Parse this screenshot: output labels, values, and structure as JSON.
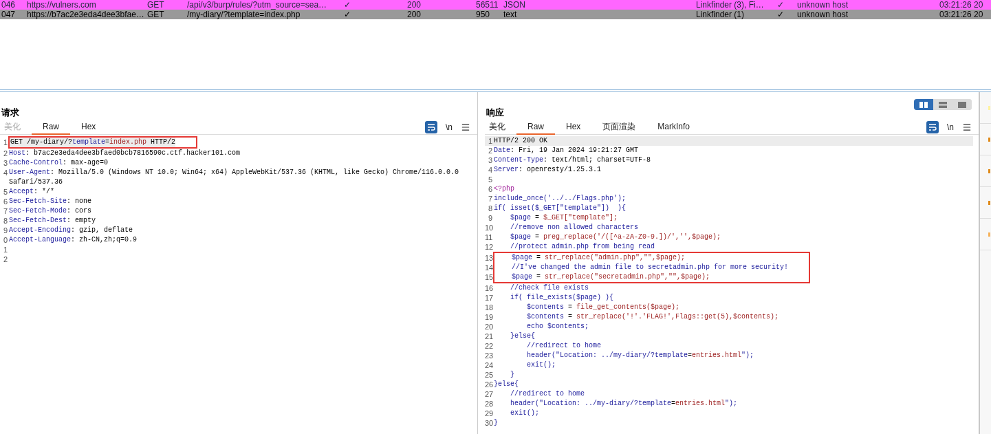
{
  "table": {
    "rows": [
      {
        "selected": false,
        "color": "#ff66ff",
        "cells": [
          "046",
          "https://vulners.com",
          "GET",
          "/api/v3/burp/rules/?utm_source=sea…",
          "✓",
          "200",
          "56511",
          "JSON",
          "Linkfinder (3), Fi…",
          "✓",
          "unknown host",
          "03:21:26 20"
        ]
      },
      {
        "selected": true,
        "color": "#999999",
        "cells": [
          "047",
          "https://b7ac2e3eda4dee3bfae…",
          "GET",
          "/my-diary/?template=index.php",
          "✓",
          "200",
          "950",
          "text",
          "Linkfinder (1)",
          "✓",
          "unknown host",
          "03:21:26 20"
        ]
      }
    ]
  },
  "request": {
    "title": "请求",
    "tabs": [
      {
        "label": "美化",
        "selected": false,
        "disabled": true
      },
      {
        "label": "Raw",
        "selected": true,
        "disabled": false
      },
      {
        "label": "Hex",
        "selected": false,
        "disabled": false
      }
    ],
    "newline_label": "\\n",
    "lines": [
      {
        "number": "1",
        "current": true,
        "boxed": true,
        "segments": [
          {
            "text": "GET /my-diary/?",
            "kind": "plain"
          },
          {
            "text": "template",
            "kind": "name"
          },
          {
            "text": "=",
            "kind": "plain"
          },
          {
            "text": "index.php",
            "kind": "value"
          },
          {
            "text": " HTTP/2",
            "kind": "plain"
          }
        ]
      },
      {
        "number": "2",
        "current": false,
        "boxed": false,
        "segments": [
          {
            "text": "Host",
            "kind": "name"
          },
          {
            "text": ": b7ac2e3eda4dee3bfaed0bcb7816590c.ctf.hacker101.com",
            "kind": "plain"
          }
        ]
      },
      {
        "number": "3",
        "current": false,
        "boxed": false,
        "segments": [
          {
            "text": "Cache-Control",
            "kind": "name"
          },
          {
            "text": ": max-age=0",
            "kind": "plain"
          }
        ]
      },
      {
        "number": "4",
        "current": false,
        "boxed": false,
        "segments": [
          {
            "text": "User-Agent",
            "kind": "name"
          },
          {
            "text": ": Mozilla/5.0 (Windows NT 10.0; Win64; x64) AppleWebKit/537.36 (KHTML, like Gecko) Chrome/116.0.0.0 Safari/537.36",
            "kind": "plain"
          }
        ]
      },
      {
        "number": "5",
        "current": false,
        "boxed": false,
        "segments": [
          {
            "text": "Accept",
            "kind": "name"
          },
          {
            "text": ": */*",
            "kind": "plain"
          }
        ]
      },
      {
        "number": "6",
        "current": false,
        "boxed": false,
        "segments": [
          {
            "text": "Sec-Fetch-Site",
            "kind": "name"
          },
          {
            "text": ": none",
            "kind": "plain"
          }
        ]
      },
      {
        "number": "7",
        "current": false,
        "boxed": false,
        "segments": [
          {
            "text": "Sec-Fetch-Mode",
            "kind": "name"
          },
          {
            "text": ": cors",
            "kind": "plain"
          }
        ]
      },
      {
        "number": "8",
        "current": false,
        "boxed": false,
        "segments": [
          {
            "text": "Sec-Fetch-Dest",
            "kind": "name"
          },
          {
            "text": ": empty",
            "kind": "plain"
          }
        ]
      },
      {
        "number": "9",
        "current": false,
        "boxed": false,
        "segments": [
          {
            "text": "Accept-Encoding",
            "kind": "name"
          },
          {
            "text": ": gzip, deflate",
            "kind": "plain"
          }
        ]
      },
      {
        "number": "0",
        "current": false,
        "boxed": false,
        "segments": [
          {
            "text": "Accept-Language",
            "kind": "name"
          },
          {
            "text": ": zh-CN,zh;q=0.9",
            "kind": "plain"
          }
        ]
      },
      {
        "number": "1",
        "current": false,
        "boxed": false
      },
      {
        "number": "2",
        "current": false,
        "boxed": false
      }
    ]
  },
  "response": {
    "title": "响应",
    "layout_toggle": [
      {
        "selected": true
      },
      {
        "selected": false
      },
      {
        "selected": false
      }
    ],
    "tabs": [
      {
        "label": "美化",
        "selected": false,
        "disabled": false
      },
      {
        "label": "Raw",
        "selected": true,
        "disabled": false
      },
      {
        "label": "Hex",
        "selected": false,
        "disabled": false
      },
      {
        "label": "页面渲染",
        "selected": false,
        "disabled": false
      },
      {
        "label": "MarkInfo",
        "selected": false,
        "disabled": false
      }
    ],
    "newline_label": "\\n",
    "lines": [
      {
        "number": "1",
        "current": true,
        "boxed": false,
        "segments": [
          {
            "text": "HTTP/2 200 OK",
            "kind": "plain"
          }
        ]
      },
      {
        "number": "2",
        "current": false,
        "boxed": false,
        "segments": [
          {
            "text": "Date",
            "kind": "name"
          },
          {
            "text": ": Fri, 19 Jan 2024 19:21:27 GMT",
            "kind": "plain"
          }
        ]
      },
      {
        "number": "3",
        "current": false,
        "boxed": false,
        "segments": [
          {
            "text": "Content-Type",
            "kind": "name"
          },
          {
            "text": ": text/html; charset=UTF-8",
            "kind": "plain"
          }
        ]
      },
      {
        "number": "4",
        "current": false,
        "boxed": false,
        "segments": [
          {
            "text": "Server",
            "kind": "name"
          },
          {
            "text": ": openresty/1.25.3.1",
            "kind": "plain"
          }
        ]
      },
      {
        "number": "5",
        "current": false,
        "boxed": false
      },
      {
        "number": "6",
        "current": false,
        "boxed": false,
        "segments": [
          {
            "text": "<?php",
            "kind": "tag"
          }
        ]
      },
      {
        "number": "7",
        "current": false,
        "boxed": false,
        "segments": [
          {
            "text": "include_once('../../Flags.php');",
            "kind": "name"
          }
        ]
      },
      {
        "number": "8",
        "current": false,
        "boxed": false,
        "segments": [
          {
            "text": "if( isset($_GET[\"template\"])  ){",
            "kind": "name"
          }
        ]
      },
      {
        "number": "9",
        "current": false,
        "boxed": false,
        "segments": [
          {
            "text": "    $page",
            "kind": "name"
          },
          {
            "text": " = ",
            "kind": "plain"
          },
          {
            "text": "$_GET[\"template\"];",
            "kind": "value"
          }
        ]
      },
      {
        "number": "10",
        "current": false,
        "boxed": false,
        "segments": [
          {
            "text": "    //remove non allowed characters",
            "kind": "name"
          }
        ]
      },
      {
        "number": "11",
        "current": false,
        "boxed": false,
        "segments": [
          {
            "text": "    $page",
            "kind": "name"
          },
          {
            "text": " = ",
            "kind": "plain"
          },
          {
            "text": "preg_replace('/([^a-zA-Z0-9.])/','',$page);",
            "kind": "value"
          }
        ]
      },
      {
        "number": "12",
        "current": false,
        "boxed": false,
        "segments": [
          {
            "text": "    //protect admin.php from being read",
            "kind": "name"
          }
        ]
      },
      {
        "number": "13",
        "current": false,
        "boxed": true,
        "segments": [
          {
            "text": "    $page",
            "kind": "name"
          },
          {
            "text": " = ",
            "kind": "plain"
          },
          {
            "text": "str_replace(\"admin.php\",\"\",$page);",
            "kind": "value"
          }
        ]
      },
      {
        "number": "14",
        "current": false,
        "boxed": true,
        "segments": [
          {
            "text": "    //I've changed the admin file to secretadmin.php for more security!",
            "kind": "name"
          }
        ]
      },
      {
        "number": "15",
        "current": false,
        "boxed": true,
        "segments": [
          {
            "text": "    $page",
            "kind": "name"
          },
          {
            "text": " = ",
            "kind": "plain"
          },
          {
            "text": "str_replace(\"secretadmin.php\",\"\",$page);",
            "kind": "value"
          }
        ]
      },
      {
        "number": "16",
        "current": false,
        "boxed": false,
        "segments": [
          {
            "text": "    //check file exists",
            "kind": "name"
          }
        ]
      },
      {
        "number": "17",
        "current": false,
        "boxed": false,
        "segments": [
          {
            "text": "    if( file_exists($page) ){",
            "kind": "name"
          }
        ]
      },
      {
        "number": "18",
        "current": false,
        "boxed": false,
        "segments": [
          {
            "text": "        $contents",
            "kind": "name"
          },
          {
            "text": " = ",
            "kind": "plain"
          },
          {
            "text": "file_get_contents($page);",
            "kind": "value"
          }
        ]
      },
      {
        "number": "19",
        "current": false,
        "boxed": false,
        "segments": [
          {
            "text": "        $contents",
            "kind": "name"
          },
          {
            "text": " = ",
            "kind": "plain"
          },
          {
            "text": "str_replace('!'.'FLAG!',Flags::get(5),$contents);",
            "kind": "value"
          }
        ]
      },
      {
        "number": "20",
        "current": false,
        "boxed": false,
        "segments": [
          {
            "text": "        echo $contents;",
            "kind": "name"
          }
        ]
      },
      {
        "number": "21",
        "current": false,
        "boxed": false,
        "segments": [
          {
            "text": "    }else{",
            "kind": "name"
          }
        ]
      },
      {
        "number": "22",
        "current": false,
        "boxed": false,
        "segments": [
          {
            "text": "        //redirect to home",
            "kind": "name"
          }
        ]
      },
      {
        "number": "23",
        "current": false,
        "boxed": false,
        "segments": [
          {
            "text": "        header(\"Location: ../my-diary/?template",
            "kind": "name"
          },
          {
            "text": "=",
            "kind": "plain"
          },
          {
            "text": "entries.html",
            "kind": "value"
          },
          {
            "text": "\");",
            "kind": "name"
          }
        ]
      },
      {
        "number": "24",
        "current": false,
        "boxed": false,
        "segments": [
          {
            "text": "        exit();",
            "kind": "name"
          }
        ]
      },
      {
        "number": "25",
        "current": false,
        "boxed": false,
        "segments": [
          {
            "text": "    }",
            "kind": "name"
          }
        ]
      },
      {
        "number": "26",
        "current": false,
        "boxed": false,
        "segments": [
          {
            "text": "}else{",
            "kind": "name"
          }
        ]
      },
      {
        "number": "27",
        "current": false,
        "boxed": false,
        "segments": [
          {
            "text": "    //redirect to home",
            "kind": "name"
          }
        ]
      },
      {
        "number": "28",
        "current": false,
        "boxed": false,
        "segments": [
          {
            "text": "    header(\"Location: ../my-diary/?template",
            "kind": "name"
          },
          {
            "text": "=",
            "kind": "plain"
          },
          {
            "text": "entries.html",
            "kind": "value"
          },
          {
            "text": "\");",
            "kind": "name"
          }
        ]
      },
      {
        "number": "29",
        "current": false,
        "boxed": false,
        "segments": [
          {
            "text": "    exit();",
            "kind": "name"
          }
        ]
      },
      {
        "number": "30",
        "current": false,
        "boxed": false,
        "segments": [
          {
            "text": "}",
            "kind": "name"
          }
        ]
      }
    ]
  }
}
